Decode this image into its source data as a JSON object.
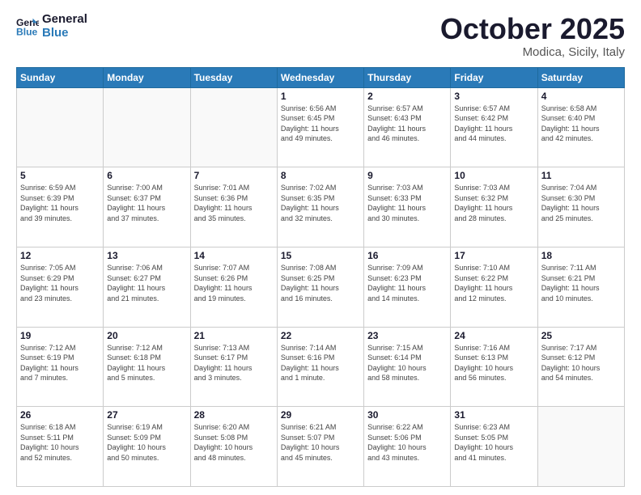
{
  "header": {
    "logo_line1": "General",
    "logo_line2": "Blue",
    "month_title": "October 2025",
    "location": "Modica, Sicily, Italy"
  },
  "days_of_week": [
    "Sunday",
    "Monday",
    "Tuesday",
    "Wednesday",
    "Thursday",
    "Friday",
    "Saturday"
  ],
  "weeks": [
    [
      {
        "day": "",
        "info": ""
      },
      {
        "day": "",
        "info": ""
      },
      {
        "day": "",
        "info": ""
      },
      {
        "day": "1",
        "info": "Sunrise: 6:56 AM\nSunset: 6:45 PM\nDaylight: 11 hours\nand 49 minutes."
      },
      {
        "day": "2",
        "info": "Sunrise: 6:57 AM\nSunset: 6:43 PM\nDaylight: 11 hours\nand 46 minutes."
      },
      {
        "day": "3",
        "info": "Sunrise: 6:57 AM\nSunset: 6:42 PM\nDaylight: 11 hours\nand 44 minutes."
      },
      {
        "day": "4",
        "info": "Sunrise: 6:58 AM\nSunset: 6:40 PM\nDaylight: 11 hours\nand 42 minutes."
      }
    ],
    [
      {
        "day": "5",
        "info": "Sunrise: 6:59 AM\nSunset: 6:39 PM\nDaylight: 11 hours\nand 39 minutes."
      },
      {
        "day": "6",
        "info": "Sunrise: 7:00 AM\nSunset: 6:37 PM\nDaylight: 11 hours\nand 37 minutes."
      },
      {
        "day": "7",
        "info": "Sunrise: 7:01 AM\nSunset: 6:36 PM\nDaylight: 11 hours\nand 35 minutes."
      },
      {
        "day": "8",
        "info": "Sunrise: 7:02 AM\nSunset: 6:35 PM\nDaylight: 11 hours\nand 32 minutes."
      },
      {
        "day": "9",
        "info": "Sunrise: 7:03 AM\nSunset: 6:33 PM\nDaylight: 11 hours\nand 30 minutes."
      },
      {
        "day": "10",
        "info": "Sunrise: 7:03 AM\nSunset: 6:32 PM\nDaylight: 11 hours\nand 28 minutes."
      },
      {
        "day": "11",
        "info": "Sunrise: 7:04 AM\nSunset: 6:30 PM\nDaylight: 11 hours\nand 25 minutes."
      }
    ],
    [
      {
        "day": "12",
        "info": "Sunrise: 7:05 AM\nSunset: 6:29 PM\nDaylight: 11 hours\nand 23 minutes."
      },
      {
        "day": "13",
        "info": "Sunrise: 7:06 AM\nSunset: 6:27 PM\nDaylight: 11 hours\nand 21 minutes."
      },
      {
        "day": "14",
        "info": "Sunrise: 7:07 AM\nSunset: 6:26 PM\nDaylight: 11 hours\nand 19 minutes."
      },
      {
        "day": "15",
        "info": "Sunrise: 7:08 AM\nSunset: 6:25 PM\nDaylight: 11 hours\nand 16 minutes."
      },
      {
        "day": "16",
        "info": "Sunrise: 7:09 AM\nSunset: 6:23 PM\nDaylight: 11 hours\nand 14 minutes."
      },
      {
        "day": "17",
        "info": "Sunrise: 7:10 AM\nSunset: 6:22 PM\nDaylight: 11 hours\nand 12 minutes."
      },
      {
        "day": "18",
        "info": "Sunrise: 7:11 AM\nSunset: 6:21 PM\nDaylight: 11 hours\nand 10 minutes."
      }
    ],
    [
      {
        "day": "19",
        "info": "Sunrise: 7:12 AM\nSunset: 6:19 PM\nDaylight: 11 hours\nand 7 minutes."
      },
      {
        "day": "20",
        "info": "Sunrise: 7:12 AM\nSunset: 6:18 PM\nDaylight: 11 hours\nand 5 minutes."
      },
      {
        "day": "21",
        "info": "Sunrise: 7:13 AM\nSunset: 6:17 PM\nDaylight: 11 hours\nand 3 minutes."
      },
      {
        "day": "22",
        "info": "Sunrise: 7:14 AM\nSunset: 6:16 PM\nDaylight: 11 hours\nand 1 minute."
      },
      {
        "day": "23",
        "info": "Sunrise: 7:15 AM\nSunset: 6:14 PM\nDaylight: 10 hours\nand 58 minutes."
      },
      {
        "day": "24",
        "info": "Sunrise: 7:16 AM\nSunset: 6:13 PM\nDaylight: 10 hours\nand 56 minutes."
      },
      {
        "day": "25",
        "info": "Sunrise: 7:17 AM\nSunset: 6:12 PM\nDaylight: 10 hours\nand 54 minutes."
      }
    ],
    [
      {
        "day": "26",
        "info": "Sunrise: 6:18 AM\nSunset: 5:11 PM\nDaylight: 10 hours\nand 52 minutes."
      },
      {
        "day": "27",
        "info": "Sunrise: 6:19 AM\nSunset: 5:09 PM\nDaylight: 10 hours\nand 50 minutes."
      },
      {
        "day": "28",
        "info": "Sunrise: 6:20 AM\nSunset: 5:08 PM\nDaylight: 10 hours\nand 48 minutes."
      },
      {
        "day": "29",
        "info": "Sunrise: 6:21 AM\nSunset: 5:07 PM\nDaylight: 10 hours\nand 45 minutes."
      },
      {
        "day": "30",
        "info": "Sunrise: 6:22 AM\nSunset: 5:06 PM\nDaylight: 10 hours\nand 43 minutes."
      },
      {
        "day": "31",
        "info": "Sunrise: 6:23 AM\nSunset: 5:05 PM\nDaylight: 10 hours\nand 41 minutes."
      },
      {
        "day": "",
        "info": ""
      }
    ]
  ]
}
